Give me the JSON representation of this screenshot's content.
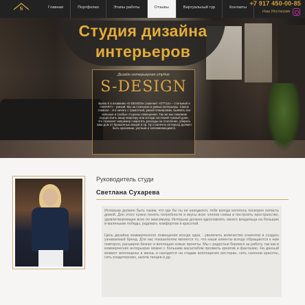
{
  "header": {
    "nav": [
      {
        "label": "Главная",
        "active": false
      },
      {
        "label": "Портфолио",
        "active": false
      },
      {
        "label": "Этапы работы",
        "active": false
      },
      {
        "label": "Отзывы",
        "active": true
      },
      {
        "label": "Виртуальный тур",
        "active": false
      },
      {
        "label": "Контакты",
        "active": false
      }
    ],
    "phone": "+7 917 450-00-85",
    "instagram_label": "Наш Инстаграм",
    "logo_icon": "s-design-logo-icon",
    "instagram_icon": "instagram-icon"
  },
  "hero": {
    "title_line1": "Студия дизайна",
    "title_line2": "интерьеров",
    "brand_tagline": "Дизайн интерьерная студия",
    "brand_logo": "S-DESIGN",
    "brand_text": "Буква S в названии «S-DESIGN» означает «STYLE» - стильный и «SMART» - умный. Мы за стильные и умные интерьеры. Самое главное - это начать с грамотной, умной планировки, выявить все сильные и слабые стороны помещения. Так же мы поможем осуществить вашу квартиру или котедж системой «умный дом», что позволит например сократить расходы на отопление, убирать ваш дом от брошенных вещей и пр. Ну и конечно интерьер должен быть красивым, уютным и запоминающимся."
  },
  "about": {
    "role": "Руководитель студи",
    "name": "Светлана Сухарева",
    "paragraph1": "Интерьер должен быть таким, что где бы ты не находился, тебе всегда хотелось поскорее попасть домой. Для этого нужно понять потребности и вкусы всех членов семьи и построить пространство, удовлетворяющее всех по максимуму. Интерьер должен вдохновлять своего владельца на большие и маленькие победы, радовать комфортом и красотой.",
    "paragraph2": "Цель дизайна коммерческого помещения всегда одна - увеличить количество клиентов и создать узнаваемый бренд. Для нас показателем является то, что наши клиенты всегда обращаются к нам повторно, расширяя бизнес и воплощая новые проекты. Мы с радостью беремся за работу, так как в коммерческих интерьерах можно с большим масштабом проявить креатив и фантазию. На данный момент воплощены в жизнь и находятся на стадии воплощения ресторан, сеть салонов красоты, сеть кондитерских, школа танцев и др."
  },
  "colors": {
    "accent": "#e2ad3a",
    "header_bg": "#222222",
    "instagram": "#c62a9f"
  }
}
